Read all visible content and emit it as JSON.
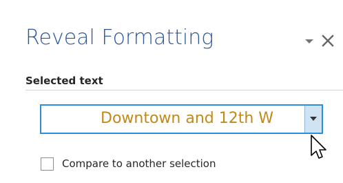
{
  "pane": {
    "title": "Reveal Formatting",
    "menu_icon": "chevron-down-icon",
    "close_icon": "close-icon",
    "close_glyph": "✕"
  },
  "selected_text": {
    "label": "Selected text",
    "value": "Downtown and 12th W",
    "value_color": "#c08a1a",
    "dropdown_icon": "dropdown-arrow-icon"
  },
  "compare": {
    "checkbox_label": "Compare to another selection",
    "checked": false
  },
  "colors": {
    "title": "#2b579a",
    "focus_border": "#2b8de0",
    "dropdown_bg": "#cfe3f3"
  }
}
